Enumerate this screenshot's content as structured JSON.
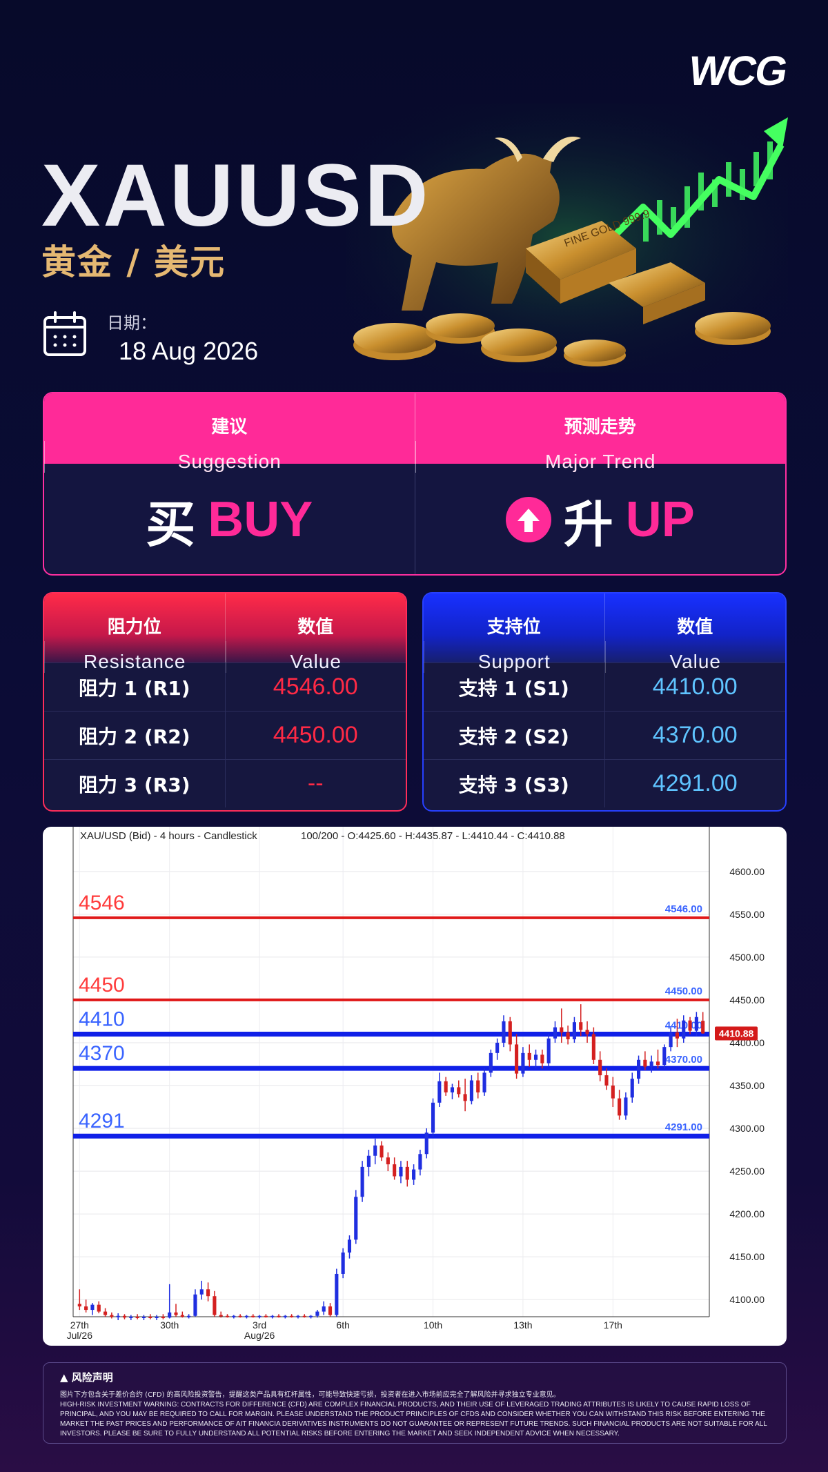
{
  "brand": {
    "logo": "WCG"
  },
  "header": {
    "symbol": "XAUUSD",
    "subtitle": "黄金 / 美元",
    "date_label": "日期：",
    "date_value": "18 Aug 2026",
    "hero_bar_text": "FINE GOLD 999.9"
  },
  "suggestion": {
    "col1": {
      "zh": "建议",
      "en": "Suggestion",
      "value_zh": "买",
      "value_en": "BUY"
    },
    "col2": {
      "zh": "预测走势",
      "en": "Major Trend",
      "value_zh": "升",
      "value_en": "UP"
    }
  },
  "resistance": {
    "header": {
      "c1_zh": "阻力位",
      "c1_en": "Resistance",
      "c2_zh": "数值",
      "c2_en": "Value"
    },
    "rows": [
      {
        "label": "阻力 1 (R1)",
        "value": "4546.00"
      },
      {
        "label": "阻力 2 (R2)",
        "value": "4450.00"
      },
      {
        "label": "阻力 3 (R3)",
        "value": "--"
      }
    ]
  },
  "support": {
    "header": {
      "c1_zh": "支持位",
      "c1_en": "Support",
      "c2_zh": "数值",
      "c2_en": "Value"
    },
    "rows": [
      {
        "label": "支持 1 (S1)",
        "value": "4410.00"
      },
      {
        "label": "支持 2 (S2)",
        "value": "4370.00"
      },
      {
        "label": "支持 3 (S3)",
        "value": "4291.00"
      }
    ]
  },
  "chart_data": {
    "type": "candlestick",
    "header_text": "XAU/USD (Bid) - 4 hours - Candlestick",
    "ohlc_text": "100/200 - O:4425.60 - H:4435.87 - L:4410.44 - C:4410.88",
    "ylim": [
      4080,
      4620
    ],
    "y_ticks": [
      "4600.00",
      "4550.00",
      "4500.00",
      "4450.00",
      "4400.00",
      "4350.00",
      "4300.00",
      "4250.00",
      "4200.00",
      "4150.00",
      "4100.00"
    ],
    "x_ticks": [
      {
        "label": "27th",
        "sub": "Jul/26"
      },
      {
        "label": "30th",
        "sub": ""
      },
      {
        "label": "3rd",
        "sub": "Aug/26"
      },
      {
        "label": "6th",
        "sub": ""
      },
      {
        "label": "10th",
        "sub": ""
      },
      {
        "label": "13th",
        "sub": ""
      },
      {
        "label": "17th",
        "sub": ""
      }
    ],
    "last_price": "4410.88",
    "levels": [
      {
        "value": 4546,
        "label": "4546",
        "tag": "4546.00",
        "kind": "resistance"
      },
      {
        "value": 4450,
        "label": "4450",
        "tag": "4450.00",
        "kind": "resistance"
      },
      {
        "value": 4410,
        "label": "4410",
        "tag": "4410.00",
        "kind": "support"
      },
      {
        "value": 4370,
        "label": "4370",
        "tag": "4370.00",
        "kind": "support"
      },
      {
        "value": 4291,
        "label": "4291",
        "tag": "4291.00",
        "kind": "support"
      }
    ],
    "candles": [
      [
        4095,
        4112,
        4088,
        4092
      ],
      [
        4092,
        4100,
        4085,
        4088
      ],
      [
        4088,
        4096,
        4082,
        4094
      ],
      [
        4094,
        4098,
        4084,
        4086
      ],
      [
        4086,
        4090,
        4080,
        4082
      ],
      [
        4082,
        4085,
        4078,
        4080
      ],
      [
        4080,
        4084,
        4076,
        4081
      ],
      [
        4081,
        4083,
        4077,
        4079
      ],
      [
        4079,
        4082,
        4076,
        4080
      ],
      [
        4080,
        4083,
        4077,
        4079
      ],
      [
        4079,
        4082,
        4076,
        4080
      ],
      [
        4080,
        4083,
        4077,
        4079
      ],
      [
        4079,
        4082,
        4076,
        4080
      ],
      [
        4080,
        4083,
        4077,
        4079
      ],
      [
        4079,
        4118,
        4078,
        4085
      ],
      [
        4085,
        4095,
        4080,
        4082
      ],
      [
        4082,
        4086,
        4079,
        4080
      ],
      [
        4080,
        4083,
        4078,
        4081
      ],
      [
        4081,
        4112,
        4080,
        4106
      ],
      [
        4106,
        4122,
        4100,
        4112
      ],
      [
        4112,
        4120,
        4098,
        4104
      ],
      [
        4104,
        4110,
        4080,
        4082
      ],
      [
        4082,
        4086,
        4079,
        4081
      ],
      [
        4081,
        4083,
        4079,
        4080
      ],
      [
        4080,
        4082,
        4078,
        4081
      ],
      [
        4081,
        4083,
        4079,
        4080
      ],
      [
        4080,
        4082,
        4078,
        4081
      ],
      [
        4081,
        4083,
        4079,
        4080
      ],
      [
        4080,
        4082,
        4078,
        4081
      ],
      [
        4081,
        4083,
        4079,
        4080
      ],
      [
        4080,
        4082,
        4078,
        4081
      ],
      [
        4081,
        4083,
        4079,
        4080
      ],
      [
        4080,
        4082,
        4078,
        4081
      ],
      [
        4081,
        4083,
        4079,
        4080
      ],
      [
        4080,
        4082,
        4078,
        4081
      ],
      [
        4081,
        4083,
        4079,
        4080
      ],
      [
        4080,
        4082,
        4078,
        4081
      ],
      [
        4081,
        4088,
        4079,
        4086
      ],
      [
        4086,
        4098,
        4082,
        4092
      ],
      [
        4092,
        4096,
        4080,
        4082
      ],
      [
        4082,
        4136,
        4080,
        4130
      ],
      [
        4130,
        4160,
        4125,
        4155
      ],
      [
        4155,
        4175,
        4148,
        4170
      ],
      [
        4170,
        4228,
        4165,
        4220
      ],
      [
        4220,
        4262,
        4214,
        4255
      ],
      [
        4255,
        4275,
        4244,
        4268
      ],
      [
        4268,
        4288,
        4258,
        4280
      ],
      [
        4280,
        4285,
        4262,
        4266
      ],
      [
        4266,
        4272,
        4250,
        4258
      ],
      [
        4258,
        4266,
        4240,
        4244
      ],
      [
        4244,
        4262,
        4236,
        4255
      ],
      [
        4255,
        4262,
        4232,
        4240
      ],
      [
        4240,
        4258,
        4234,
        4252
      ],
      [
        4252,
        4275,
        4245,
        4270
      ],
      [
        4270,
        4300,
        4265,
        4295
      ],
      [
        4295,
        4335,
        4290,
        4330
      ],
      [
        4330,
        4365,
        4325,
        4355
      ],
      [
        4355,
        4360,
        4338,
        4342
      ],
      [
        4342,
        4352,
        4334,
        4348
      ],
      [
        4348,
        4356,
        4336,
        4340
      ],
      [
        4340,
        4358,
        4320,
        4332
      ],
      [
        4332,
        4362,
        4328,
        4356
      ],
      [
        4356,
        4365,
        4335,
        4342
      ],
      [
        4342,
        4370,
        4338,
        4365
      ],
      [
        4365,
        4392,
        4360,
        4388
      ],
      [
        4388,
        4405,
        4380,
        4400
      ],
      [
        4400,
        4432,
        4395,
        4425
      ],
      [
        4425,
        4430,
        4390,
        4398
      ],
      [
        4398,
        4410,
        4358,
        4364
      ],
      [
        4364,
        4395,
        4360,
        4388
      ],
      [
        4388,
        4398,
        4372,
        4380
      ],
      [
        4380,
        4392,
        4370,
        4386
      ],
      [
        4386,
        4392,
        4370,
        4376
      ],
      [
        4376,
        4410,
        4372,
        4405
      ],
      [
        4405,
        4425,
        4400,
        4418
      ],
      [
        4418,
        4440,
        4400,
        4412
      ],
      [
        4412,
        4420,
        4398,
        4404
      ],
      [
        4404,
        4430,
        4400,
        4424
      ],
      [
        4424,
        4445,
        4408,
        4415
      ],
      [
        4415,
        4425,
        4400,
        4410
      ],
      [
        4410,
        4418,
        4375,
        4380
      ],
      [
        4380,
        4390,
        4355,
        4362
      ],
      [
        4362,
        4370,
        4345,
        4350
      ],
      [
        4350,
        4360,
        4325,
        4335
      ],
      [
        4335,
        4345,
        4310,
        4315
      ],
      [
        4315,
        4342,
        4310,
        4336
      ],
      [
        4336,
        4365,
        4330,
        4358
      ],
      [
        4358,
        4385,
        4352,
        4380
      ],
      [
        4380,
        4390,
        4368,
        4372
      ],
      [
        4372,
        4385,
        4365,
        4378
      ],
      [
        4378,
        4392,
        4370,
        4374
      ],
      [
        4374,
        4398,
        4370,
        4395
      ],
      [
        4395,
        4418,
        4390,
        4412
      ],
      [
        4412,
        4428,
        4395,
        4405
      ],
      [
        4405,
        4432,
        4400,
        4426
      ],
      [
        4426,
        4430,
        4410,
        4414
      ],
      [
        4414,
        4436,
        4408,
        4430
      ],
      [
        4425.6,
        4435.87,
        4410.44,
        4410.88
      ]
    ]
  },
  "disclaimer": {
    "title": "风险声明",
    "zh": "图片下方包含关于差价合约 (CFD) 的高风险投资警告，提醒这类产品具有杠杆属性，可能导致快速亏损，投资者在进入市场前应完全了解风险并寻求独立专业意见。",
    "en": "High-risk investment warning: Contracts for difference (CFD) are complex financial products, and their use of leveraged trading attributes is likely to cause rapid loss of principal, and you may be required to call for margin. Please understand the product principles of CFDs and consider whether you can withstand this risk before entering the market the past prices and performance of AIT Financia derivatives instruments do not guarantee or represent future trends. Such financial products are not suitable for all investors. Please be sure to fully understand all potential risks before entering the market and seek independent advice when necessary."
  },
  "colors": {
    "accent": "#ff2a98",
    "resistance": "#ff2a45",
    "support": "#2c3cff",
    "support_value": "#5fc4ff",
    "gold": "#e5b872",
    "candle_up": "#1f2ee0",
    "candle_down": "#d42020"
  }
}
